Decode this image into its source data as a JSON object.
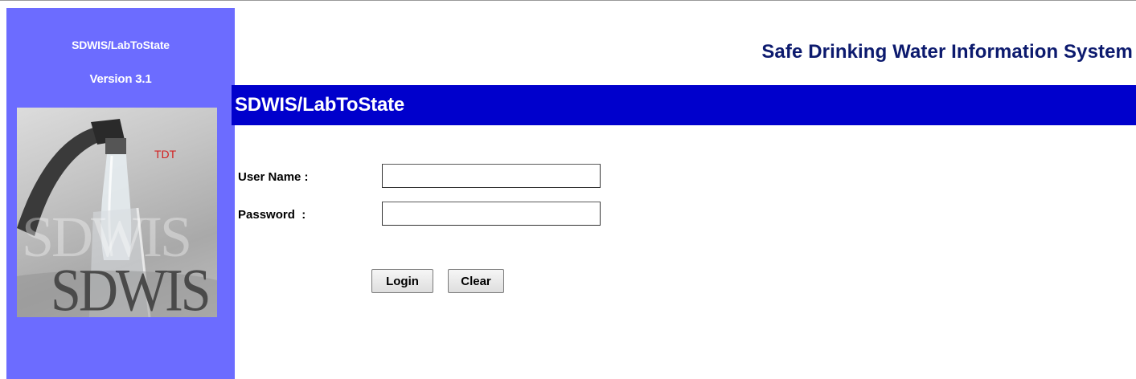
{
  "sidebar": {
    "product_name": "SDWIS/LabToState",
    "version": "Version 3.1",
    "logo": {
      "badge": "TDT",
      "watermark": "SDWIS",
      "wordmark": "SDWIS",
      "icon": "faucet-water-icon"
    },
    "background_color": "#6c6cff"
  },
  "header": {
    "app_title": "Safe Drinking Water Information System",
    "banner_title": "SDWIS/LabToState",
    "banner_color": "#0000cc",
    "title_color": "#0c1a6e"
  },
  "login_form": {
    "username_label": "User Name :",
    "username_value": "",
    "password_label": "Password  :",
    "password_value": "",
    "login_label": "Login",
    "clear_label": "Clear"
  }
}
